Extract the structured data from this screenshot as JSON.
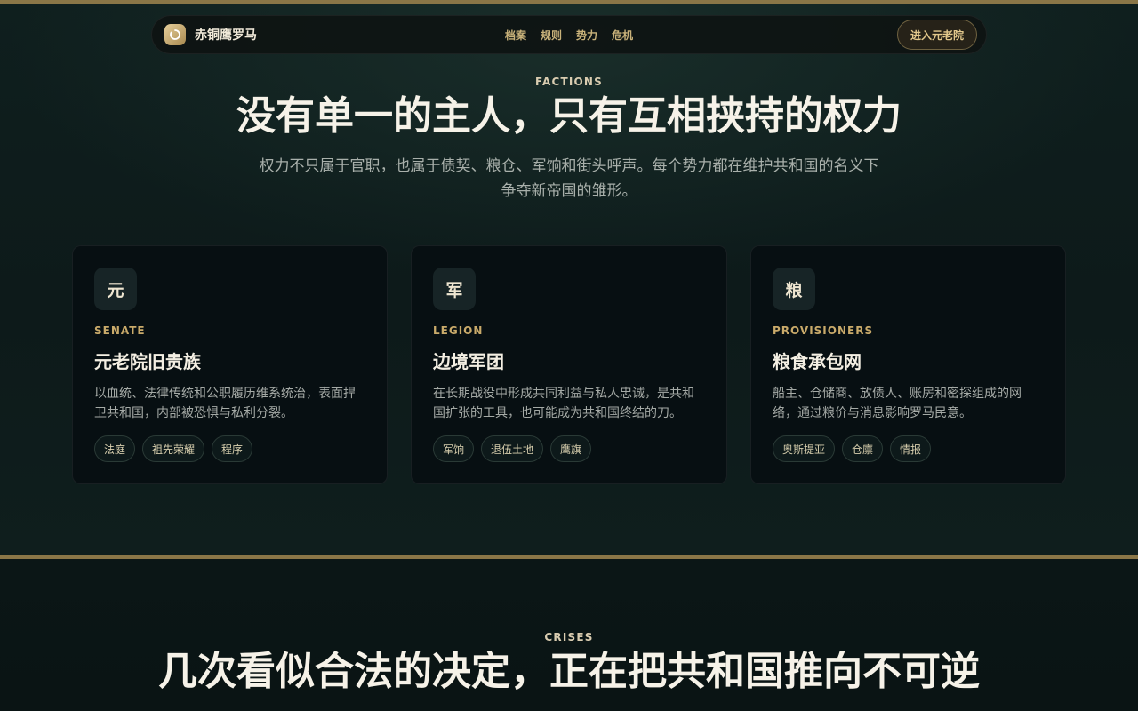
{
  "nav": {
    "brand": "赤铜鹰罗马",
    "links": [
      "档案",
      "规则",
      "势力",
      "危机"
    ],
    "cta": "进入元老院"
  },
  "factions": {
    "eyebrow": "FACTIONS",
    "title": "没有单一的主人，只有互相挟持的权力",
    "lede": "权力不只属于官职，也属于债契、粮仓、军饷和街头呼声。每个势力都在维护共和国的名义下争夺新帝国的雏形。",
    "cards": [
      {
        "icon": "元",
        "kicker": "SENATE",
        "title": "元老院旧贵族",
        "desc": "以血统、法律传统和公职履历维系统治，表面捍卫共和国，内部被恐惧与私利分裂。",
        "tags": [
          "法庭",
          "祖先荣耀",
          "程序"
        ]
      },
      {
        "icon": "军",
        "kicker": "LEGION",
        "title": "边境军团",
        "desc": "在长期战役中形成共同利益与私人忠诚，是共和国扩张的工具，也可能成为共和国终结的刀。",
        "tags": [
          "军饷",
          "退伍土地",
          "鹰旗"
        ]
      },
      {
        "icon": "粮",
        "kicker": "PROVISIONERS",
        "title": "粮食承包网",
        "desc": "船主、仓储商、放债人、账房和密探组成的网络，通过粮价与消息影响罗马民意。",
        "tags": [
          "奥斯提亚",
          "仓廪",
          "情报"
        ]
      }
    ]
  },
  "crises": {
    "eyebrow": "CRISES",
    "title": "几次看似合法的决定，正在把共和国推向不可逆"
  },
  "colors": {
    "gold_rule": "#8a7647",
    "accent": "#c9aa6a",
    "background": "#0d1a1a",
    "card": "#070f12"
  }
}
